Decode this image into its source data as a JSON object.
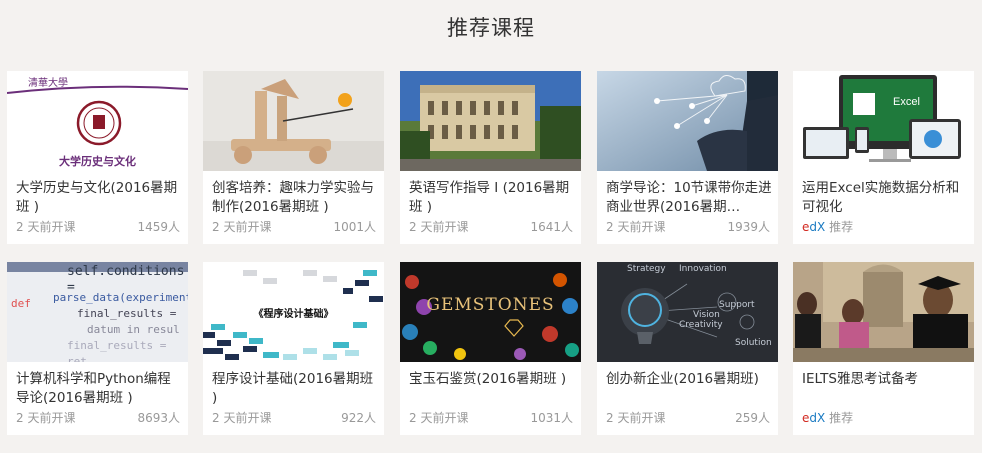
{
  "section_title": "推荐课程",
  "courses": [
    {
      "title": "大学历史与文化(2016暑期班 )",
      "time": "2 天前开课",
      "count": "1459人",
      "thumb_text": "大学历史与文化",
      "logo_text": "清華大學"
    },
    {
      "title": "创客培养：趣味力学实验与制作(2016暑期班 )",
      "time": "2 天前开课",
      "count": "1001人"
    },
    {
      "title": "英语写作指导 I (2016暑期班 )",
      "time": "2 天前开课",
      "count": "1641人"
    },
    {
      "title": "商学导论：10节课带你走进商业世界(2016暑期…",
      "time": "2 天前开课",
      "count": "1939人"
    },
    {
      "title": "运用Excel实施数据分析和可视化",
      "source_e": "e",
      "source_dx": "dX",
      "source_label": "推荐",
      "thumb_text": "Excel"
    },
    {
      "title": "计算机科学和Python编程导论(2016暑期班 )",
      "time": "2 天前开课",
      "count": "8693人",
      "code_lines": [
        "self.conditions =",
        "parse_data(experiment",
        "final_results =",
        "datum in resul",
        "final_results = ret"
      ],
      "code_kw": "def"
    },
    {
      "title": "程序设计基础(2016暑期班 )",
      "time": "2 天前开课",
      "count": "922人",
      "thumb_text": "《程序设计基础》"
    },
    {
      "title": "宝玉石鉴赏(2016暑期班 )",
      "time": "2 天前开课",
      "count": "1031人",
      "thumb_text": "GEMSTONES"
    },
    {
      "title": "创办新企业(2016暑期班)",
      "time": "2 天前开课",
      "count": "259人",
      "thumb_words": [
        "Strategy",
        "Innovation",
        "Support",
        "Vision",
        "Creativity",
        "Solution"
      ]
    },
    {
      "title": "IELTS雅思考试备考",
      "source_e": "e",
      "source_dx": "dX",
      "source_label": "推荐"
    }
  ]
}
